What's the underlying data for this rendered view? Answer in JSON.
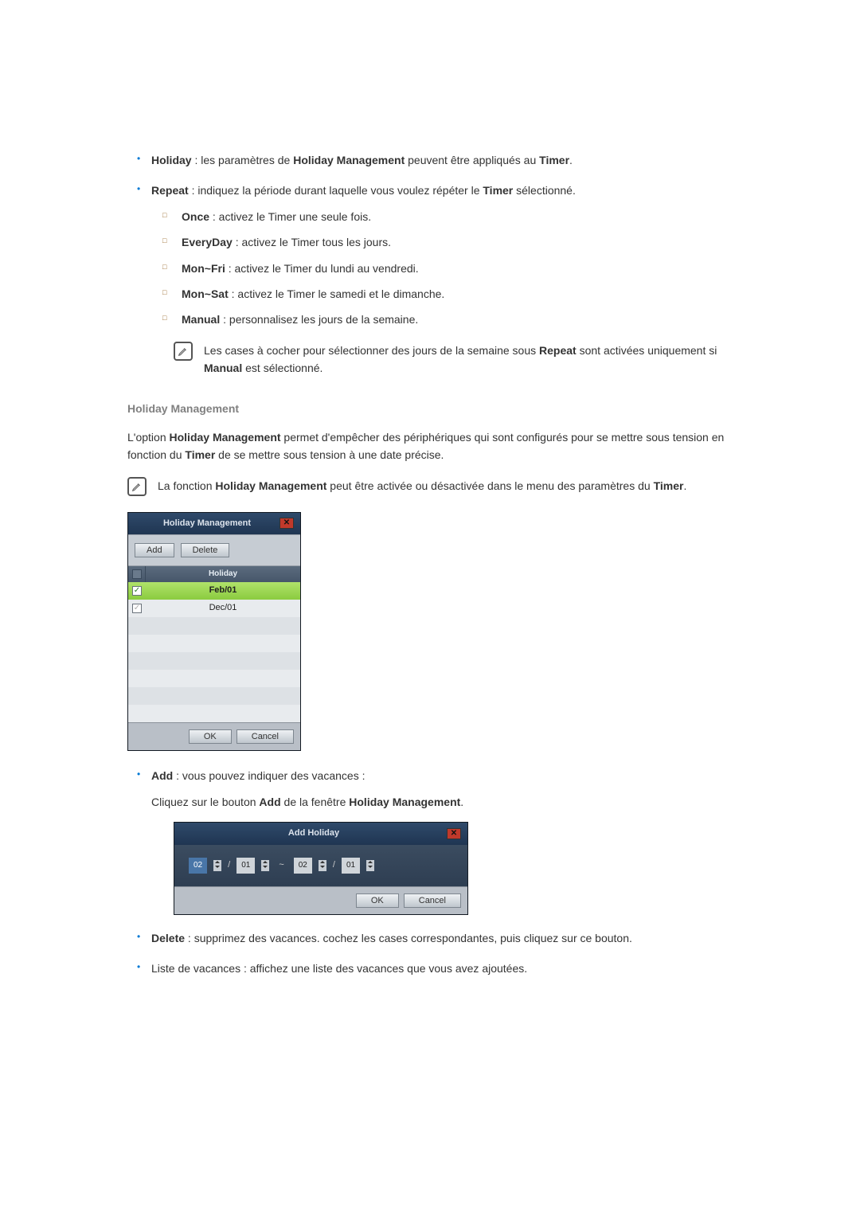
{
  "bullets": {
    "holiday": {
      "term": "Holiday",
      "text": " : les paramètres de ",
      "term2": "Holiday Management",
      "text2": " peuvent être appliqués au ",
      "term3": "Timer",
      "text3": "."
    },
    "repeat": {
      "term": "Repeat",
      "text": " : indiquez la période durant laquelle vous voulez répéter le ",
      "term2": "Timer",
      "text2": " sélectionné."
    },
    "sub": {
      "once": {
        "term": "Once",
        "text": " : activez le Timer une seule fois."
      },
      "everyday": {
        "term": "EveryDay",
        "text": " : activez le Timer tous les jours."
      },
      "monfri": {
        "term": "Mon~Fri",
        "text": " : activez le Timer du lundi au vendredi."
      },
      "monsat": {
        "term": "Mon~Sat",
        "text": " : activez le Timer le samedi et le dimanche."
      },
      "manual": {
        "term": "Manual",
        "text": " : personnalisez les jours de la semaine."
      }
    },
    "add": {
      "term": "Add",
      "text": " : vous pouvez indiquer des vacances :"
    },
    "add_line2a": "Cliquez sur le bouton ",
    "add_line2b": "Add",
    "add_line2c": " de la fenêtre ",
    "add_line2d": "Holiday Management",
    "add_line2e": ".",
    "delete": {
      "term": "Delete",
      "text": " : supprimez des vacances. cochez les cases correspondantes, puis cliquez sur ce bouton."
    },
    "list": {
      "text": "Liste de vacances : affichez une liste des vacances que vous avez ajoutées."
    }
  },
  "note1a": "Les cases à cocher pour sélectionner des jours de la semaine sous ",
  "note1b": "Repeat",
  "note1c": " sont activées uniquement si ",
  "note1d": "Manual",
  "note1e": " est sélectionné.",
  "section_title": "Holiday Management",
  "intro1": "L'option ",
  "intro2": "Holiday Management",
  "intro3": " permet d'empêcher des périphériques qui sont configurés pour se mettre sous tension en fonction du ",
  "intro4": "Timer",
  "intro5": " de se mettre sous tension à une date précise.",
  "note2a": "La fonction ",
  "note2b": "Holiday Management",
  "note2c": " peut être activée ou désactivée dans le menu des paramètres du ",
  "note2d": "Timer",
  "note2e": ".",
  "dialog1": {
    "title": "Holiday Management",
    "add_btn": "Add",
    "delete_btn": "Delete",
    "col_holiday": "Holiday",
    "rows": {
      "r0": "Feb/01",
      "r1": "Dec/01"
    },
    "ok": "OK",
    "cancel": "Cancel"
  },
  "dialog2": {
    "title": "Add Holiday",
    "m1": "02",
    "d1": "01",
    "m2": "02",
    "d2": "01",
    "tilde": "~",
    "ok": "OK",
    "cancel": "Cancel"
  }
}
